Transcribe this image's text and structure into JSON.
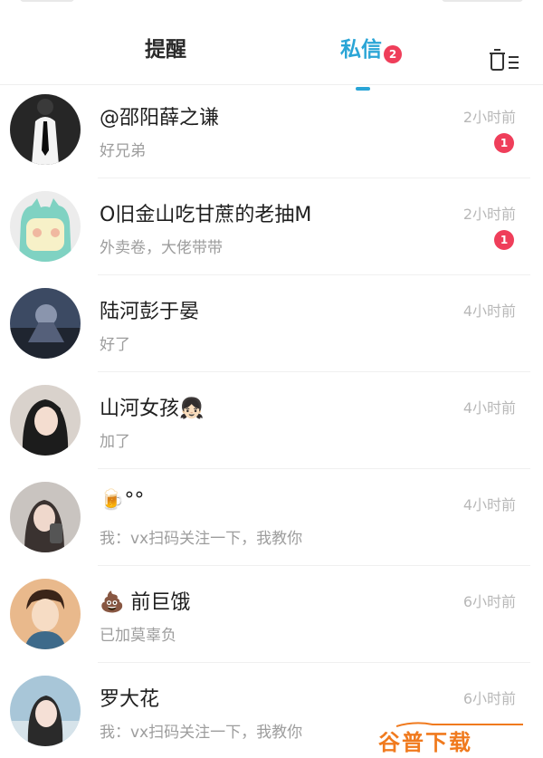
{
  "tabs": {
    "reminder_label": "提醒",
    "messages_label": "私信",
    "messages_badge": "2"
  },
  "header": {
    "clear_icon": "trash-list-icon"
  },
  "conversations": [
    {
      "name": "@邵阳薛之谦",
      "preview": "好兄弟",
      "time": "2小时前",
      "unread": "1",
      "avatar": "man-in-suit"
    },
    {
      "name": "O旧金山吃甘蔗的老抽M",
      "preview": "外卖卷，大佬带带",
      "time": "2小时前",
      "unread": "1",
      "avatar": "green-cartoon-bear"
    },
    {
      "name": "陆河彭于晏",
      "preview": "好了",
      "time": "4小时前",
      "unread": "",
      "avatar": "dark-photo"
    },
    {
      "name": "山河女孩👧🏻",
      "preview": "加了",
      "time": "4小时前",
      "unread": "",
      "avatar": "girl-portrait"
    },
    {
      "name": "🍺°°",
      "preview": "我：vx扫码关注一下，我教你",
      "time": "4小时前",
      "unread": "",
      "avatar": "girl-selfie"
    },
    {
      "name": "💩 前巨饿",
      "preview": "已加莫辜负",
      "time": "6小时前",
      "unread": "",
      "avatar": "boy-illustration"
    },
    {
      "name": "罗大花",
      "preview": "我：vx扫码关注一下，我教你",
      "time": "6小时前",
      "unread": "",
      "avatar": "girl-outdoor"
    }
  ],
  "watermark": {
    "text": "谷普下载"
  },
  "colors": {
    "accent": "#2aa5d6",
    "badge": "#ef3e5a",
    "watermark": "#f07a1e"
  }
}
